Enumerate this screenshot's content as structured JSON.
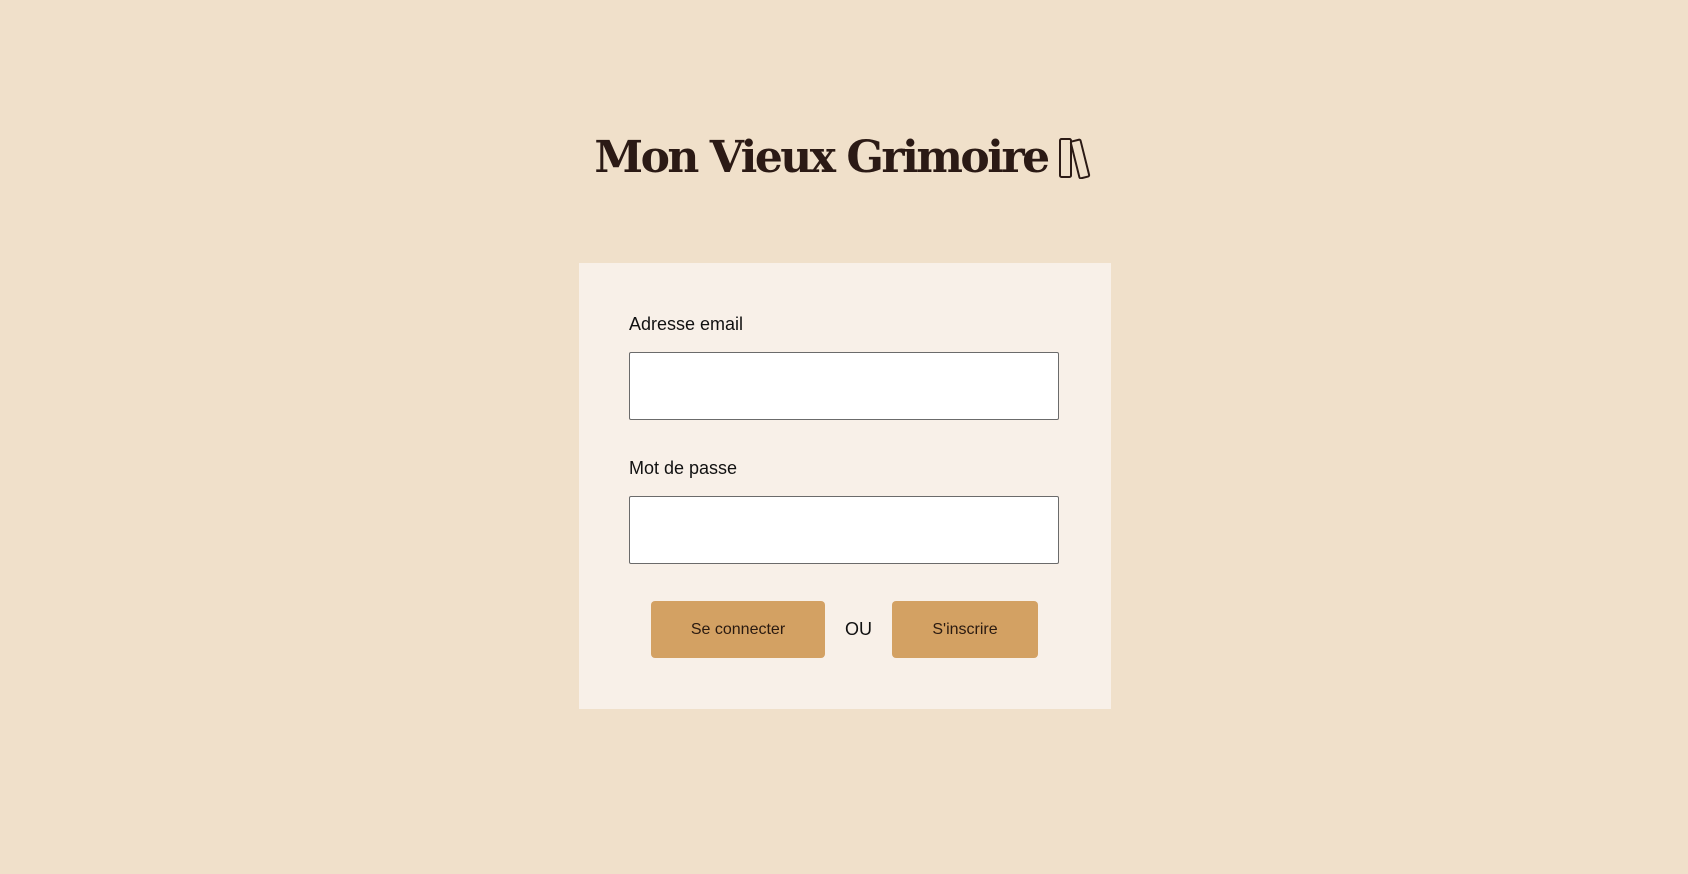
{
  "header": {
    "title": "Mon Vieux Grimoire",
    "logo_icon": "books-icon"
  },
  "login_form": {
    "email_label": "Adresse email",
    "email_value": "",
    "password_label": "Mot de passe",
    "password_value": "",
    "login_button": "Se connecter",
    "separator": "OU",
    "signup_button": "S'inscrire"
  },
  "colors": {
    "background": "#F0E0CA",
    "card": "#F8F0E8",
    "button": "#D3A163",
    "title": "#2B1A15"
  }
}
